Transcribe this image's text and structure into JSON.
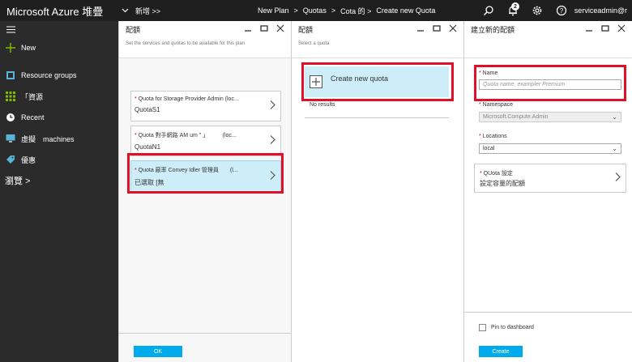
{
  "topbar": {
    "brand": "Microsoft Azure 堆疊",
    "new_crumb": "新增 >>",
    "crumbs": [
      "New Plan",
      ">",
      "Quotas",
      ">",
      "Cota 的 >",
      "Create new Quota"
    ],
    "notification_count": "2",
    "user": "serviceadmin@r"
  },
  "sidebar": {
    "new_label": "New",
    "items": [
      {
        "label": "Resource groups",
        "icon": "resource-groups-icon"
      },
      {
        "label": "「資源",
        "icon": "grid-icon"
      },
      {
        "label": "Recent",
        "icon": "clock-icon"
      },
      {
        "label": "虛擬　machines",
        "icon": "monitor-icon"
      },
      {
        "label": "優惠",
        "icon": "tag-icon"
      }
    ],
    "more_label": "瀏覽 >"
  },
  "blade1": {
    "title": "配額",
    "subtitle": "Set the services and quotas to be available for this plan",
    "cards": [
      {
        "line1_req": "* ",
        "line1": "Quota for Storage Provider Admin (loc...",
        "line2": "QuotaS1"
      },
      {
        "line1_req": "* ",
        "line1": "Quota 對手網路 AM um \" 」　　　(loc...",
        "line2": "QuotaN1"
      },
      {
        "line1_req": "* ",
        "line1": "Quota 蔽率 Convey Idler 管理員　　(l...",
        "line2": "已選取 [無"
      }
    ],
    "ok_label": "OK"
  },
  "blade2": {
    "title": "配額",
    "subtitle": "Select a quota",
    "create_label": "Create new quota",
    "no_results": "No results"
  },
  "blade3": {
    "title": "建立新的配額",
    "name_label": "Name",
    "name_placeholder": "Quota name, exampler Premium",
    "namespace_label": "Namespace",
    "namespace_value": "Microsoft.Compute.Admin",
    "locations_label": "Locations",
    "locations_value": "local",
    "quota_settings_label": "QUota 設定",
    "quota_settings_value": "設定容量的配額",
    "pin_label": "Pin to dashboard",
    "create_label": "Create"
  },
  "colors": {
    "accent": "#00abec",
    "highlight": "#e0102a",
    "selected_bg": "#cdeef9"
  }
}
